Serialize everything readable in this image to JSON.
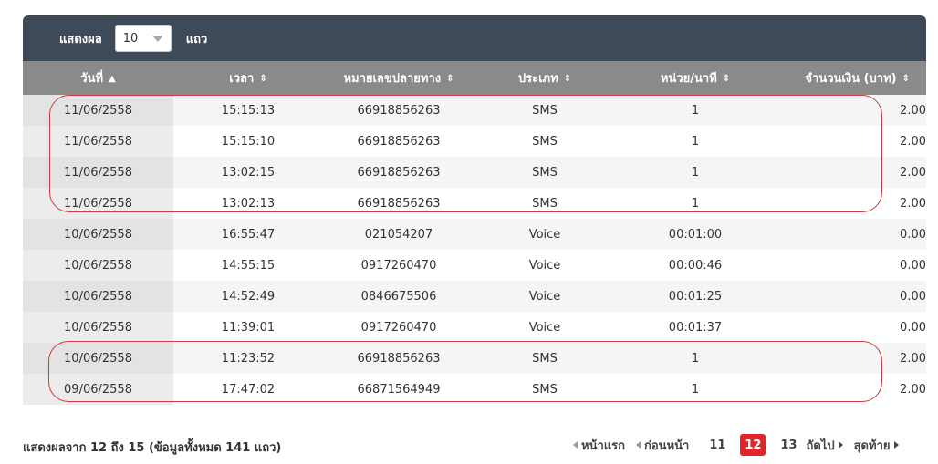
{
  "toolbar": {
    "show_label": "แสดงผล",
    "page_size": "10",
    "rows_label": "แถว"
  },
  "columns": [
    {
      "label": "วันที่",
      "sort": "▲"
    },
    {
      "label": "เวลา",
      "sort": "⇕"
    },
    {
      "label": "หมายเลขปลายทาง",
      "sort": "⇕"
    },
    {
      "label": "ประเภท",
      "sort": "⇕"
    },
    {
      "label": "หน่วย/นาที",
      "sort": "⇕"
    },
    {
      "label": "จำนวนเงิน (บาท)",
      "sort": "⇕"
    }
  ],
  "rows": [
    [
      "11/06/2558",
      "15:15:13",
      "66918856263",
      "SMS",
      "1",
      "2.00"
    ],
    [
      "11/06/2558",
      "15:15:10",
      "66918856263",
      "SMS",
      "1",
      "2.00"
    ],
    [
      "11/06/2558",
      "13:02:15",
      "66918856263",
      "SMS",
      "1",
      "2.00"
    ],
    [
      "11/06/2558",
      "13:02:13",
      "66918856263",
      "SMS",
      "1",
      "2.00"
    ],
    [
      "10/06/2558",
      "16:55:47",
      "021054207",
      "Voice",
      "00:01:00",
      "0.00"
    ],
    [
      "10/06/2558",
      "14:55:15",
      "0917260470",
      "Voice",
      "00:00:46",
      "0.00"
    ],
    [
      "10/06/2558",
      "14:52:49",
      "0846675506",
      "Voice",
      "00:01:25",
      "0.00"
    ],
    [
      "10/06/2558",
      "11:39:01",
      "0917260470",
      "Voice",
      "00:01:37",
      "0.00"
    ],
    [
      "10/06/2558",
      "11:23:52",
      "66918856263",
      "SMS",
      "1",
      "2.00"
    ],
    [
      "09/06/2558",
      "17:47:02",
      "66871564949",
      "SMS",
      "1",
      "2.00"
    ]
  ],
  "footer": {
    "info": "แสดงผลจาก 12 ถึง 15 (ข้อมูลทั้งหมด 141 แถว)"
  },
  "pager": {
    "first": "หน้าแรก",
    "prev": "ก่อนหน้า",
    "pages": [
      "11",
      "12",
      "13"
    ],
    "active_page": "12",
    "next": "ถัดไป",
    "last": "สุดท้าย"
  },
  "colors": {
    "header_dark": "#3e4a58",
    "header_grey": "#8a8a8a",
    "active": "#e0252b",
    "highlight": "#d33a3a"
  }
}
